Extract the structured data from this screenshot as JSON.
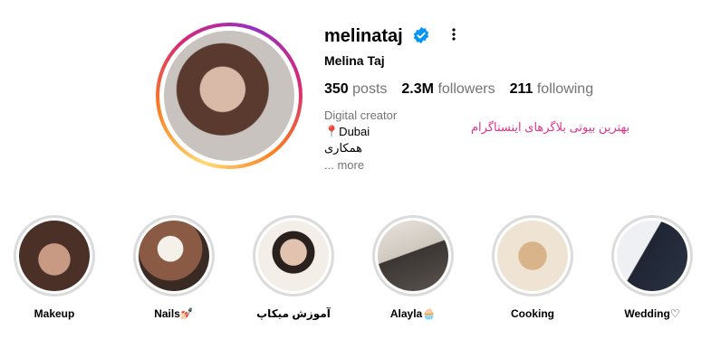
{
  "profile": {
    "username": "melinataj",
    "full_name": "Melina Taj",
    "stats": {
      "posts_count": "350",
      "posts_label": "posts",
      "followers_count": "2.3M",
      "followers_label": "followers",
      "following_count": "211",
      "following_label": "following"
    },
    "category": "Digital creator",
    "bio_line_1": "📍Dubai",
    "bio_line_2": "همکاری",
    "more_label": "... more",
    "persian_caption": "بهترین بیوتی بلاگرهای اینستاگرام"
  },
  "highlights": [
    {
      "label": "Makeup"
    },
    {
      "label": "Nails💅🏻"
    },
    {
      "label": "آموزش میکاپ"
    },
    {
      "label": "Alayla🧁"
    },
    {
      "label": "Cooking"
    },
    {
      "label": "Wedding♡"
    }
  ],
  "colors": {
    "verified_blue": "#0095f6",
    "caption_pink": "#e0348a",
    "muted_text": "#737373"
  }
}
